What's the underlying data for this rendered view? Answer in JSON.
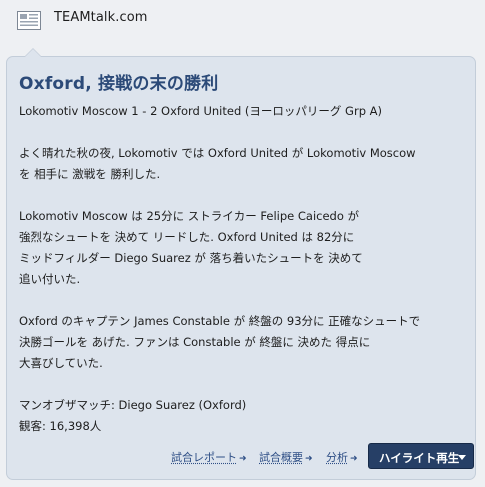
{
  "source": {
    "name": "TEAMtalk.com",
    "icon": "newspaper-icon"
  },
  "article": {
    "headline": "Oxford, 接戦の末の勝利",
    "score_line": "Lokomotiv Moscow 1 - 2 Oxford United (ヨーロッパリーグ Grp A)",
    "paragraph_1": "よく晴れた秋の夜, Lokomotiv では Oxford United が Lokomotiv Moscow\nを 相手に 激戦を 勝利した.",
    "paragraph_2": "Lokomotiv Moscow は 25分に ストライカー Felipe Caicedo が\n強烈なシュートを 決めて リードした. Oxford United は 82分に\nミッドフィルダー Diego Suarez が 落ち着いたシュートを 決めて\n追い付いた.",
    "paragraph_3": "Oxford のキャプテン James Constable が 終盤の 93分に 正確なシュートで\n決勝ゴールを あげた. ファンは Constable が 終盤に 決めた 得点に\n大喜びしていた.",
    "man_of_the_match": "マンオブザマッチ: Diego Suarez (Oxford)",
    "attendance": "観客: 16,398人"
  },
  "actions": {
    "match_report": "試合レポート",
    "match_summary": "試合概要",
    "analysis": "分析",
    "highlights_button": "ハイライト再生"
  },
  "colors": {
    "headline": "#2c4a78",
    "card_bg": "#dde4ed",
    "button_bg": "#263f66",
    "link": "#2f4f86"
  }
}
